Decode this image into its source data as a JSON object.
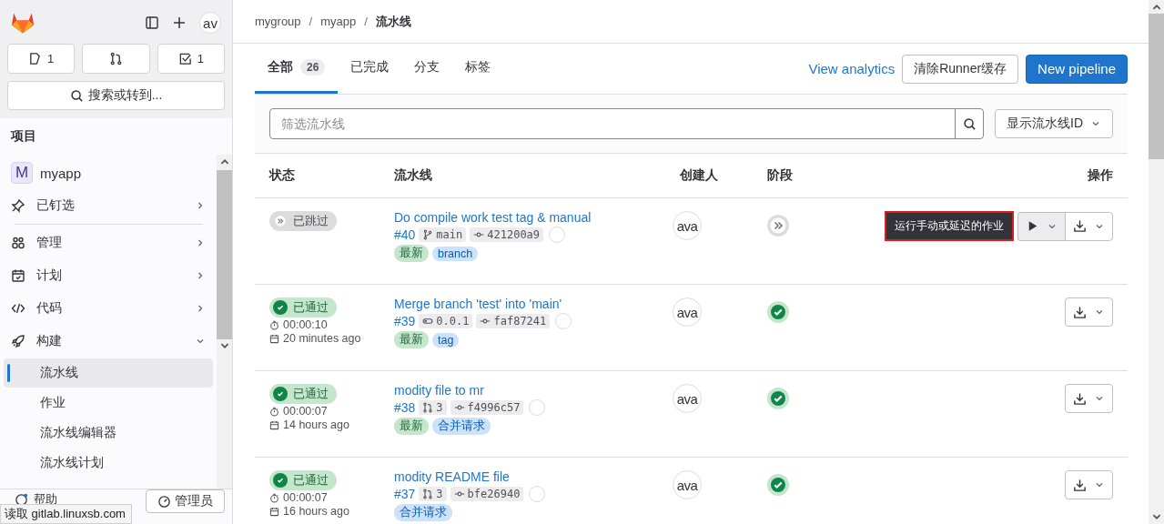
{
  "sidebar": {
    "counters": [
      {
        "kind": "issues",
        "count": "1"
      },
      {
        "kind": "merge_requests"
      },
      {
        "kind": "todos",
        "count": "1"
      }
    ],
    "avatar": "av",
    "search": "搜索或转到...",
    "section_title": "项目",
    "project": {
      "initial": "M",
      "name": "myapp"
    },
    "items": [
      {
        "kind": "pin",
        "label": "已钉选",
        "expanded": false
      },
      {
        "kind": "manage",
        "label": "管理",
        "expanded": false
      },
      {
        "kind": "plan",
        "label": "计划",
        "expanded": false
      },
      {
        "kind": "code",
        "label": "代码",
        "expanded": false
      },
      {
        "kind": "build",
        "label": "构建",
        "expanded": true,
        "children": [
          {
            "label": "流水线",
            "selected": true
          },
          {
            "label": "作业",
            "selected": false
          },
          {
            "label": "流水线编辑器",
            "selected": false
          },
          {
            "label": "流水线计划",
            "selected": false
          }
        ]
      }
    ],
    "help": "帮助",
    "admin": "管理员"
  },
  "status_bar": "读取 gitlab.linuxsb.com",
  "breadcrumb": [
    "mygroup",
    "myapp",
    "流水线"
  ],
  "breadcrumb_separator": "/",
  "tabs": [
    {
      "label": "全部",
      "count": "26",
      "selected": true
    },
    {
      "label": "已完成",
      "selected": false
    },
    {
      "label": "分支",
      "selected": false
    },
    {
      "label": "标签",
      "selected": false
    }
  ],
  "actions": {
    "link": "View analytics",
    "secondary": "清除Runner缓存",
    "primary": "New pipeline"
  },
  "filter": {
    "placeholder": "筛选流水线",
    "dropdown": "显示流水线ID"
  },
  "table": {
    "columns": [
      "状态",
      "流水线",
      "创建人",
      "阶段",
      "操作"
    ],
    "rows": [
      {
        "status": {
          "kind": "skipped",
          "label": "已跳过"
        },
        "title": "Do compile work test tag & manual",
        "id": "#40",
        "ref": {
          "kind": "branch",
          "name": "main"
        },
        "sha": "421200a9",
        "badges": [
          {
            "kind": "latest",
            "label": "最新"
          },
          {
            "kind": "info",
            "label": "branch"
          }
        ],
        "avatar": "ava",
        "stages": [
          {
            "kind": "skipped"
          }
        ],
        "manual": true,
        "tooltip": "运行手动或延迟的作业"
      },
      {
        "status": {
          "kind": "success",
          "label": "已通过"
        },
        "duration": "00:00:10",
        "finished": "20 minutes ago",
        "title": "Merge branch 'test' into 'main'",
        "id": "#39",
        "ref": {
          "kind": "tag",
          "name": "0.0.1"
        },
        "sha": "faf87241",
        "badges": [
          {
            "kind": "latest",
            "label": "最新"
          },
          {
            "kind": "info",
            "label": "tag"
          }
        ],
        "avatar": "ava",
        "stages": [
          {
            "kind": "success"
          }
        ],
        "manual": false
      },
      {
        "status": {
          "kind": "success",
          "label": "已通过"
        },
        "duration": "00:00:07",
        "finished": "14 hours ago",
        "title": "modity file to mr",
        "id": "#38",
        "ref": {
          "kind": "merge_request",
          "name": "3"
        },
        "sha": "f4996c57",
        "badges": [
          {
            "kind": "latest",
            "label": "最新"
          },
          {
            "kind": "info",
            "label": "合并请求"
          }
        ],
        "avatar": "ava",
        "stages": [
          {
            "kind": "success"
          }
        ],
        "manual": false
      },
      {
        "status": {
          "kind": "success",
          "label": "已通过"
        },
        "duration": "00:00:07",
        "finished": "16 hours ago",
        "title": "modity README file",
        "id": "#37",
        "ref": {
          "kind": "merge_request",
          "name": "3"
        },
        "sha": "bfe26940",
        "badges": [
          {
            "kind": "info",
            "label": "合并请求"
          }
        ],
        "avatar": "ava",
        "stages": [
          {
            "kind": "success"
          }
        ],
        "manual": false
      }
    ]
  }
}
